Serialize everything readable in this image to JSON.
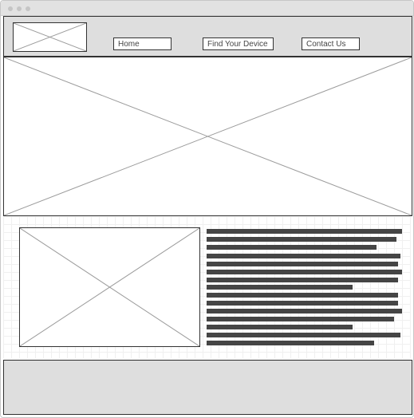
{
  "window": {
    "controls": [
      "window-control-dot",
      "window-control-dot",
      "window-control-dot"
    ]
  },
  "header": {
    "logo_icon": "image-placeholder-icon",
    "nav": [
      {
        "label": "Home"
      },
      {
        "label": "Find Your Device"
      },
      {
        "label": "Contact Us"
      }
    ]
  },
  "hero": {
    "icon": "image-placeholder-icon"
  },
  "content": {
    "image_icon": "image-placeholder-icon",
    "text_line_fill": [
      0.98,
      0.95,
      0.85,
      0.97,
      0.96,
      0.98,
      0.96,
      0.73,
      0.96,
      0.96,
      0.98,
      0.94,
      0.73,
      0.97,
      0.84
    ]
  },
  "colors": {
    "header_background": "#dedede",
    "footer_background": "#dedede",
    "text_line": "#454545",
    "border": "#333333",
    "placeholder_cross": "#9b9b9b"
  },
  "footer": {
    "content": ""
  }
}
